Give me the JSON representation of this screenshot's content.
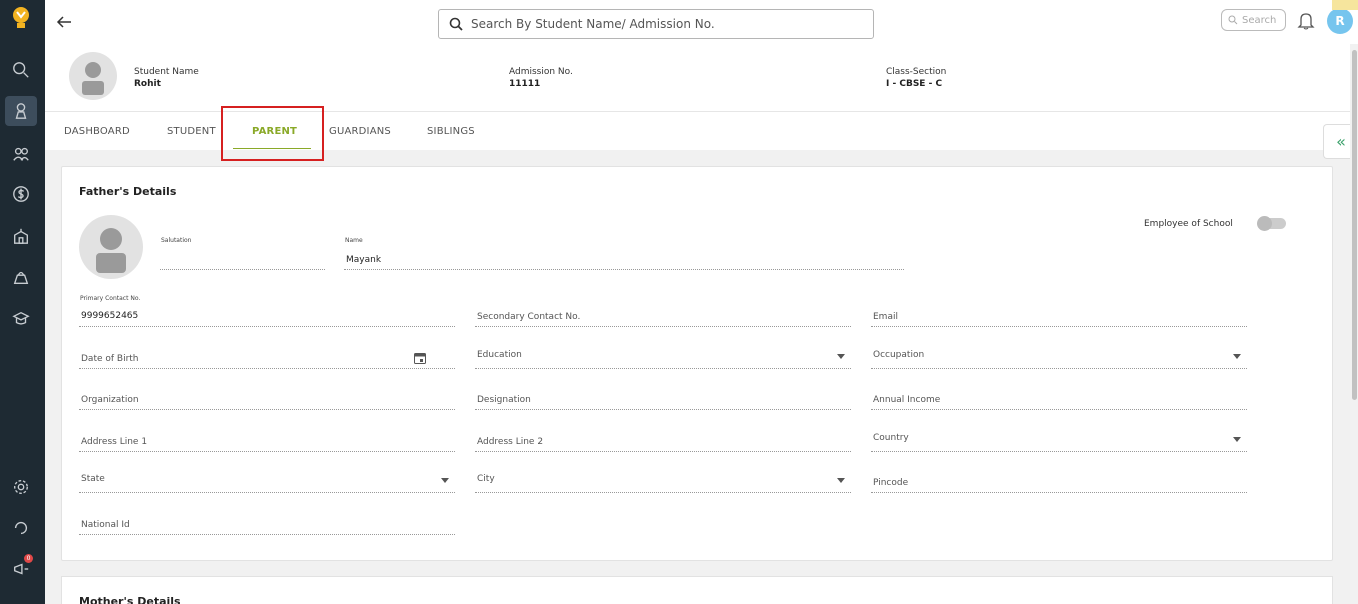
{
  "search": {
    "placeholder": "Search By Student Name/ Admission No."
  },
  "top_search": {
    "label": "Search"
  },
  "user": {
    "initial": "R",
    "avatar_color": "#76c5ee"
  },
  "sidebar": {
    "notification_count": "0"
  },
  "student": {
    "name_label": "Student Name",
    "name": "Rohit",
    "admission_label": "Admission No.",
    "admission_no": "11111",
    "class_label": "Class-Section",
    "class_section": "I - CBSE - C"
  },
  "tabs": [
    {
      "label": "DASHBOARD"
    },
    {
      "label": "STUDENT"
    },
    {
      "label": "PARENT"
    },
    {
      "label": "GUARDIANS"
    },
    {
      "label": "SIBLINGS"
    }
  ],
  "collapse_icon": "«",
  "father": {
    "title": "Father's Details",
    "employee_label": "Employee of School",
    "employee_toggle": "off",
    "salutation_label": "Salutation",
    "name_label": "Name",
    "name_value": "Mayank",
    "primary_label": "Primary Contact No.",
    "primary_value": "9999652465",
    "secondary_ph": "Secondary Contact No.",
    "email_ph": "Email",
    "dob_ph": "Date of Birth",
    "education_ph": "Education",
    "occupation_ph": "Occupation",
    "organization_ph": "Organization",
    "designation_ph": "Designation",
    "income_ph": "Annual Income",
    "address1_ph": "Address Line 1",
    "address2_ph": "Address Line 2",
    "country_ph": "Country",
    "state_ph": "State",
    "city_ph": "City",
    "pincode_ph": "Pincode",
    "national_ph": "National Id"
  },
  "mother": {
    "title": "Mother's Details"
  },
  "colors": {
    "accent": "#8aa928",
    "highlight": "#d62020",
    "sidebar": "#1e2a33"
  }
}
